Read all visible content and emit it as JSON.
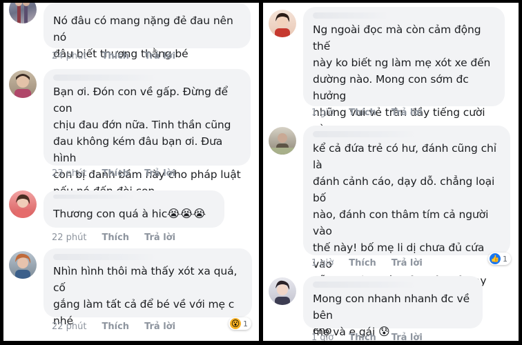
{
  "left_panel": {
    "comments": [
      {
        "text": "Nó đâu có mang nặng đẻ đau nên nó\nđâu biết thương thằng bé",
        "time": "24 phút",
        "like_label": "Thích",
        "reply_label": "Trả lời",
        "avatar_icon": "user-avatar"
      },
      {
        "text": "Bạn ơi. Đón con về gấp. Đừng để con\nchịu đau đớn nữa. Tinh thần cũng\nđau không kém đâu bạn ơi. Đưa hình\ncon bị đanh bầm này cho pháp luật\nnếu nó đến đòi con",
        "time": "23 phút",
        "like_label": "Thích",
        "reply_label": "Trả lời",
        "avatar_icon": "user-avatar"
      },
      {
        "text": "Thương con quá à hic",
        "emojis": "😭😭😭",
        "time": "22 phút",
        "like_label": "Thích",
        "reply_label": "Trả lời",
        "avatar_icon": "user-avatar"
      },
      {
        "text": "Nhìn hình thôi mà thấy xót xa quá,  cố\ngắng làm tất cả để bé về với mẹ c\nnhé",
        "time": "22 phút",
        "like_label": "Thích",
        "reply_label": "Trả lời",
        "avatar_icon": "user-avatar",
        "reaction": {
          "icon": "wow-reaction-icon",
          "glyph": "😮",
          "count": "1"
        }
      }
    ]
  },
  "right_panel": {
    "comments": [
      {
        "text": "Ng ngoài đọc mà còn cảm động thế\nnày ko biết ng làm mẹ xót xe đến\ndường nào. Mong con sớm đc hưởng\nnhững vui vẻ tràn đầy tiếng cười và\nđc chăm sóc cẩn thận con nhé.",
        "time": "1 giờ",
        "like_label": "Thích",
        "reply_label": "Trả lời",
        "avatar_icon": "user-avatar"
      },
      {
        "text": "kể cả đứa trẻ có hư, đánh cũng chỉ là\nđánh cảnh cáo, dạy dỗ. chẳng loại bố\nnào, đánh con thâm tím cả người vào\nthế này! bố mẹ li dị chưa đủ cứa vào\nnỗi đau tâm hồn của trẻ nhỏ hay sao,\nmà lại reo thêm nỗi đau thể xác cho\nbé!!!",
        "time": "1 giờ",
        "like_label": "Thích",
        "reply_label": "Trả lời",
        "avatar_icon": "user-avatar",
        "reaction": {
          "icon": "like-reaction-icon",
          "glyph": "👍",
          "count": "1"
        }
      },
      {
        "text": "Mong con nhanh nhanh đc về bên\nmẹ và e gái",
        "emojis": "😰",
        "time": "1 giờ",
        "like_label": "Thích",
        "reply_label": "Trả lời",
        "avatar_icon": "user-avatar"
      }
    ]
  },
  "colors": {
    "bubble": "#f2f3f5",
    "text": "#1c1e21",
    "meta": "#8d949e",
    "like_blue": "#1877f2",
    "wow_yellow": "#f7b125"
  }
}
